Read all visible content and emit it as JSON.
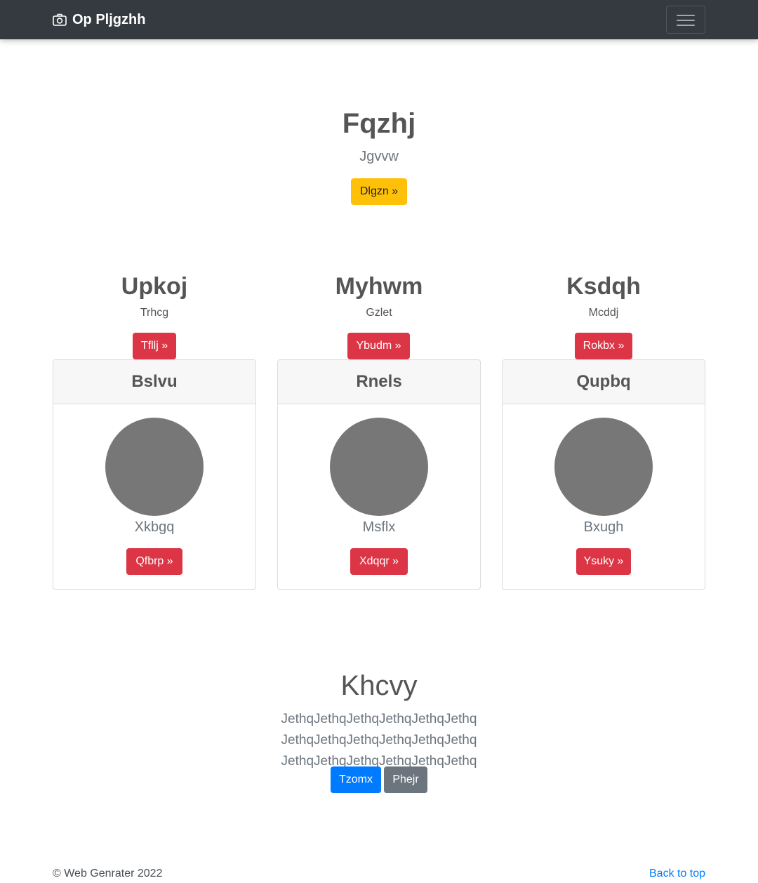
{
  "navbar": {
    "brand": "Op Pljgzhh",
    "brand_icon": "camera-icon",
    "toggler_icon": "hamburger-icon"
  },
  "hero": {
    "title": "Fqzhj",
    "subtitle": "Jgvvw",
    "button": "Dlgzn »"
  },
  "columns": [
    {
      "heading": "Upkoj",
      "sub": "Trhcg",
      "button": "Tfllj »"
    },
    {
      "heading": "Myhwm",
      "sub": "Gzlet",
      "button": "Ybudm »"
    },
    {
      "heading": "Ksdqh",
      "sub": "Mcddj",
      "button": "Rokbx »"
    }
  ],
  "cards": [
    {
      "header": "Bslvu",
      "caption": "Xkbgq",
      "button": "Qfbrp »"
    },
    {
      "header": "Rnels",
      "caption": "Msflx",
      "button": "Xdqqr »"
    },
    {
      "header": "Qupbq",
      "caption": "Bxugh",
      "button": "Ysuky »"
    }
  ],
  "section": {
    "title": "Khcvy",
    "body": "JethqJethqJethqJethqJethqJethq JethqJethqJethqJethqJethqJethq JethqJethqJethqJethqJethqJethq",
    "primary_button": "Tzomx",
    "secondary_button": "Phejr"
  },
  "footer": {
    "copyright": "© Web Genrater 2022",
    "back_to_top": "Back to top"
  },
  "colors": {
    "navbar": "#343a40",
    "warning": "#ffc107",
    "danger": "#dc3545",
    "primary": "#007bff",
    "secondary": "#6c757d",
    "avatar": "#777777"
  }
}
